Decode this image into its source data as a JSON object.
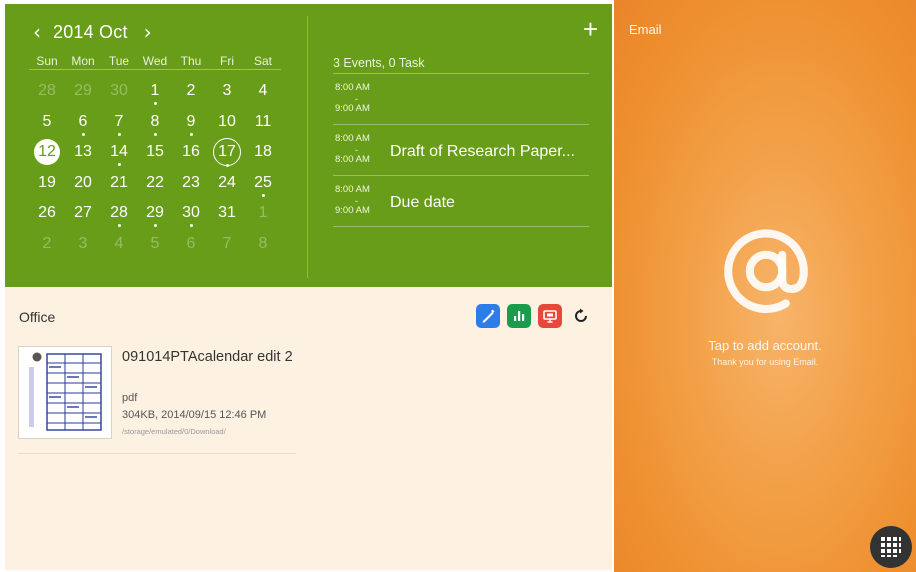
{
  "calendar": {
    "month_label": "2014 Oct",
    "prev_icon": "chevron-left-icon",
    "next_icon": "chevron-right-icon",
    "weekdays": [
      "Sun",
      "Mon",
      "Tue",
      "Wed",
      "Thu",
      "Fri",
      "Sat"
    ],
    "weeks": [
      [
        {
          "d": "28",
          "dim": true
        },
        {
          "d": "29",
          "dim": true
        },
        {
          "d": "30",
          "dim": true
        },
        {
          "d": "1",
          "dot": true
        },
        {
          "d": "2"
        },
        {
          "d": "3"
        },
        {
          "d": "4"
        }
      ],
      [
        {
          "d": "5"
        },
        {
          "d": "6",
          "dot": true
        },
        {
          "d": "7",
          "dot": true
        },
        {
          "d": "8",
          "dot": true
        },
        {
          "d": "9",
          "dot": true
        },
        {
          "d": "10"
        },
        {
          "d": "11"
        }
      ],
      [
        {
          "d": "12",
          "today": true
        },
        {
          "d": "13"
        },
        {
          "d": "14",
          "dot": true
        },
        {
          "d": "15"
        },
        {
          "d": "16"
        },
        {
          "d": "17",
          "selected": true,
          "dot": true
        },
        {
          "d": "18"
        }
      ],
      [
        {
          "d": "19"
        },
        {
          "d": "20"
        },
        {
          "d": "21"
        },
        {
          "d": "22"
        },
        {
          "d": "23"
        },
        {
          "d": "24"
        },
        {
          "d": "25",
          "dot": true
        }
      ],
      [
        {
          "d": "26"
        },
        {
          "d": "27"
        },
        {
          "d": "28",
          "dot": true
        },
        {
          "d": "29",
          "dot": true
        },
        {
          "d": "30",
          "dot": true
        },
        {
          "d": "31"
        },
        {
          "d": "1",
          "dim": true
        }
      ],
      [
        {
          "d": "2",
          "dim": true
        },
        {
          "d": "3",
          "dim": true
        },
        {
          "d": "4",
          "dim": true
        },
        {
          "d": "5",
          "dim": true
        },
        {
          "d": "6",
          "dim": true
        },
        {
          "d": "7",
          "dim": true
        },
        {
          "d": "8",
          "dim": true
        }
      ]
    ],
    "add_icon": "plus-icon",
    "add_label": "+",
    "summary": "3 Events, 0 Task",
    "events": [
      {
        "start": "8:00 AM",
        "sep": "-",
        "end": "9:00 AM",
        "title": ""
      },
      {
        "start": "8:00 AM",
        "sep": "-",
        "end": "8:00 AM",
        "title": "Draft of Research Paper..."
      },
      {
        "start": "8:00 AM",
        "sep": "-",
        "end": "9:00 AM",
        "title": "Due date"
      }
    ],
    "accent_color": "#679d18"
  },
  "office": {
    "title": "Office",
    "apps": [
      {
        "name": "word-app-icon",
        "color": "#2d7de8"
      },
      {
        "name": "spreadsheet-app-icon",
        "color": "#1b9b4c"
      },
      {
        "name": "presentation-app-icon",
        "color": "#e8473c"
      }
    ],
    "refresh_icon": "refresh-icon",
    "documents": [
      {
        "name": "091014PTAcalendar edit 2",
        "type": "pdf",
        "meta": "304KB, 2014/09/15 12:46 PM",
        "path": "/storage/emulated/0/Download/"
      }
    ]
  },
  "email": {
    "title": "Email",
    "icon": "at-sign-icon",
    "message": "Tap to add account.",
    "sub_message": "Thank you for using Email.",
    "color": "#ee8f2e"
  },
  "apps_button": {
    "icon": "app-grid-icon"
  }
}
